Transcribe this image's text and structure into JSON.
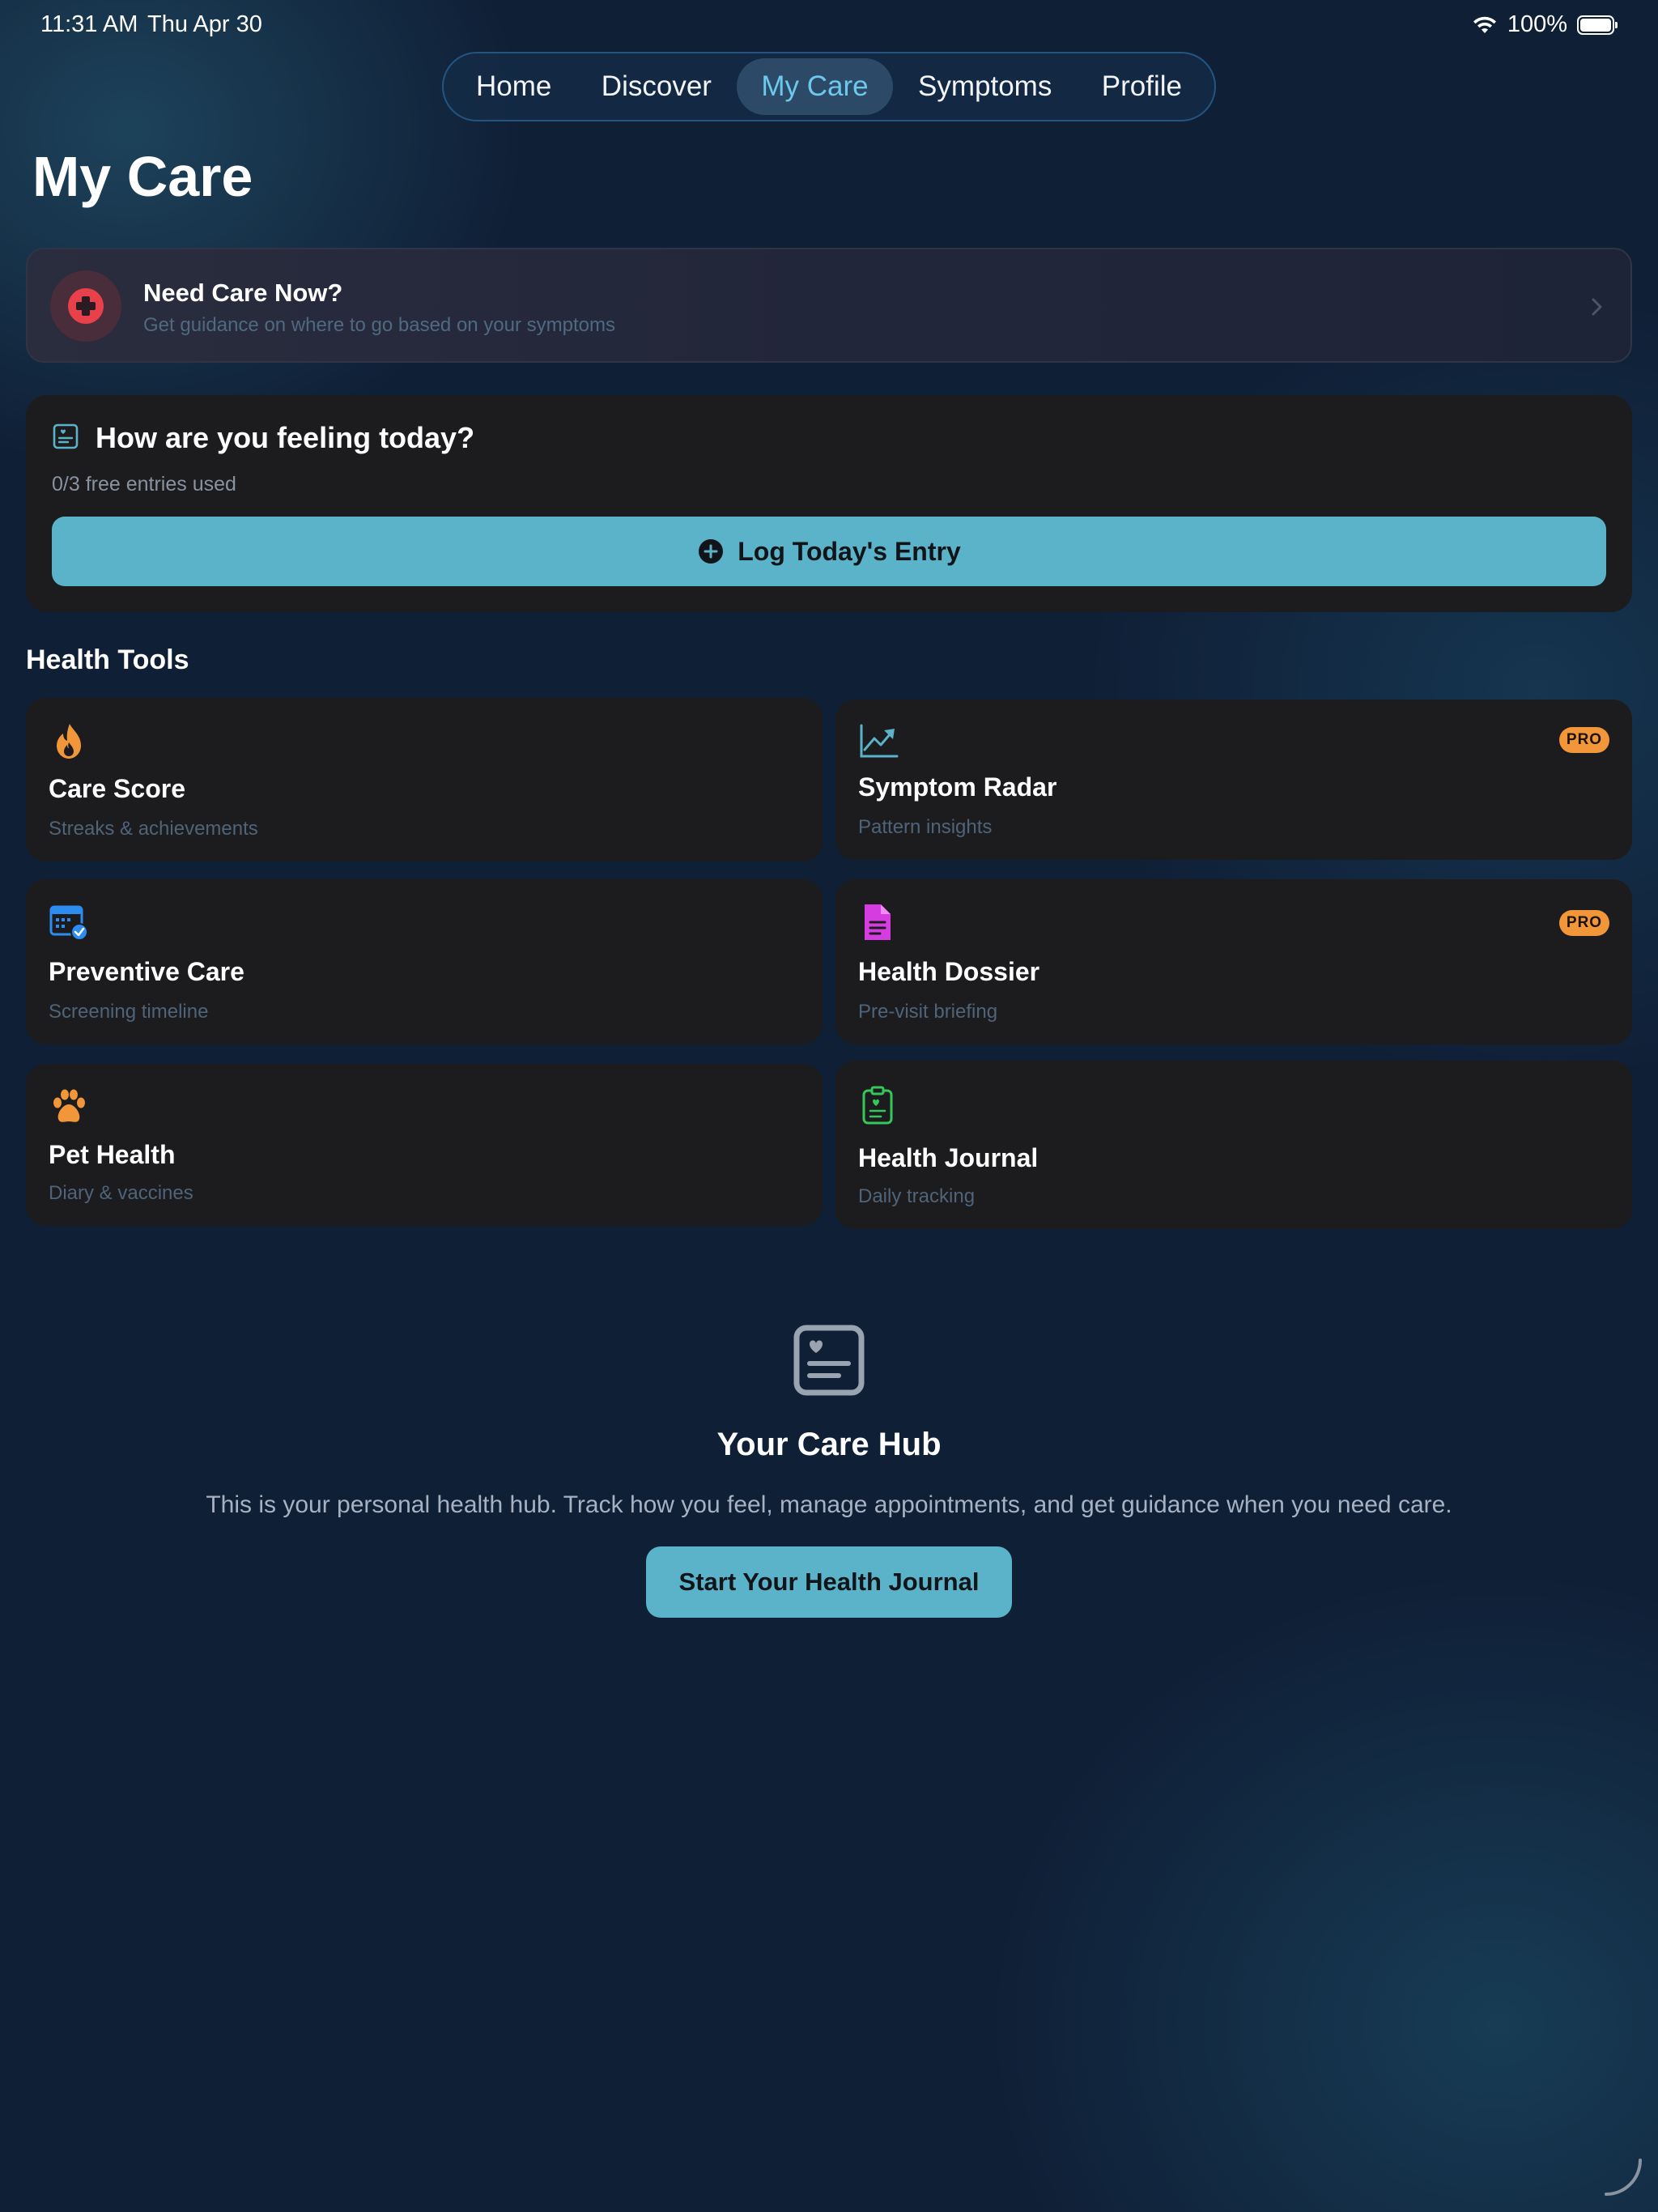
{
  "status_bar": {
    "time": "11:31 AM",
    "date": "Thu Apr 30",
    "battery": "100%",
    "icons": [
      "wifi-icon",
      "battery-icon"
    ]
  },
  "nav": {
    "tabs": [
      {
        "label": "Home",
        "active": false
      },
      {
        "label": "Discover",
        "active": false
      },
      {
        "label": "My Care",
        "active": true
      },
      {
        "label": "Symptoms",
        "active": false
      },
      {
        "label": "Profile",
        "active": false
      }
    ]
  },
  "page": {
    "title": "My Care"
  },
  "care_now": {
    "title": "Need Care Now?",
    "subtitle": "Get guidance on where to go based on your symptoms",
    "icon": "medical-cross-icon",
    "accent": "#e8414b"
  },
  "feeling": {
    "title": "How are you feeling today?",
    "entries_used": "0/3 free entries used",
    "button_label": "Log Today's Entry"
  },
  "health_tools": {
    "title": "Health Tools",
    "items": [
      {
        "title": "Care Score",
        "subtitle": "Streaks & achievements",
        "icon": "flame-icon",
        "color": "#f2963a",
        "pro": false
      },
      {
        "title": "Symptom Radar",
        "subtitle": "Pattern insights",
        "icon": "trend-chart-icon",
        "color": "#5ab3c8",
        "pro": true,
        "badge": "PRO"
      },
      {
        "title": "Preventive Care",
        "subtitle": "Screening timeline",
        "icon": "calendar-check-icon",
        "color": "#2d8cf0",
        "pro": false
      },
      {
        "title": "Health Dossier",
        "subtitle": "Pre-visit briefing",
        "icon": "document-icon",
        "color": "#d63de0",
        "pro": true,
        "badge": "PRO"
      },
      {
        "title": "Pet Health",
        "subtitle": "Diary & vaccines",
        "icon": "paw-icon",
        "color": "#f2963a",
        "pro": false
      },
      {
        "title": "Health Journal",
        "subtitle": "Daily tracking",
        "icon": "clipboard-heart-icon",
        "color": "#34c759",
        "pro": false
      }
    ]
  },
  "hub": {
    "title": "Your Care Hub",
    "description": "This is your personal health hub. Track how you feel, manage appointments, and get guidance when you need care.",
    "button_label": "Start Your Health Journal",
    "icon": "heart-card-icon"
  },
  "colors": {
    "background": "#0f1f36",
    "card": "#1c1c1f",
    "accent": "#5ab3c8",
    "active_tab_text": "#6cc9ec",
    "pro_badge": "#f2963a"
  }
}
